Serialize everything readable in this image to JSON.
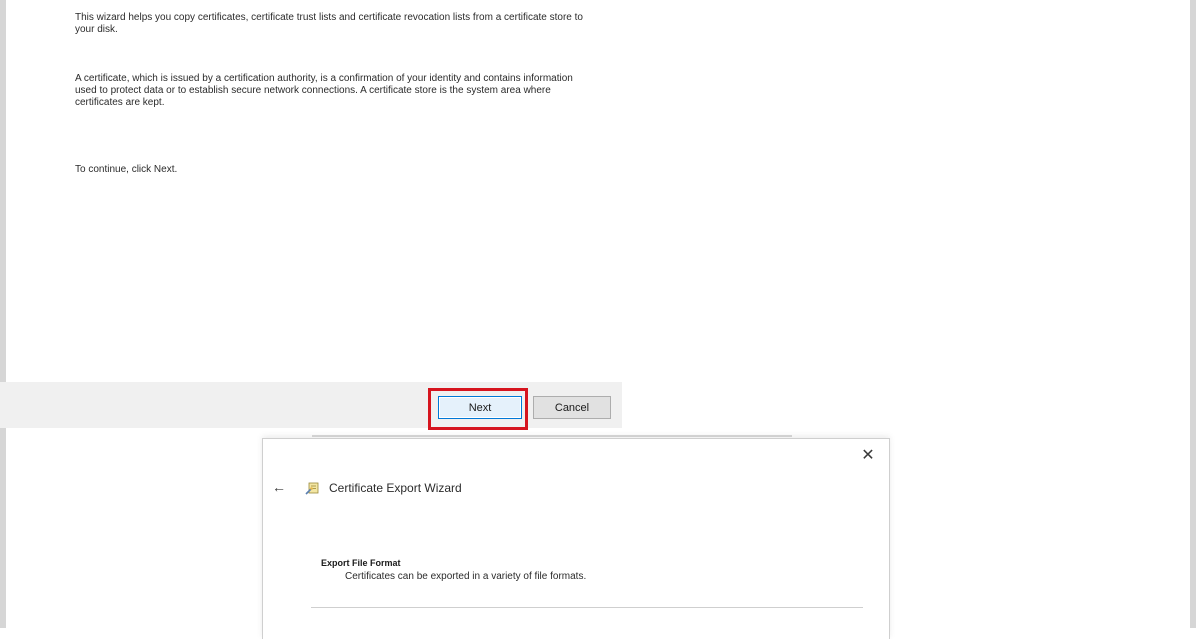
{
  "wizard_intro": {
    "paragraph1": "This wizard helps you copy certificates, certificate trust lists and certificate revocation lists from a certificate store to your disk.",
    "paragraph2": "A certificate, which is issued by a certification authority, is a confirmation of your identity and contains information used to protect data or to establish secure network connections. A certificate store is the system area where certificates are kept.",
    "paragraph3": "To continue, click Next."
  },
  "footer": {
    "next_label": "Next",
    "cancel_label": "Cancel",
    "highlight_color": "#d6141e"
  },
  "export_wizard": {
    "title": "Certificate Export Wizard",
    "close_icon": "close-icon",
    "back_icon": "back-arrow-icon",
    "app_icon": "certificate-wizard-icon",
    "section_title": "Export File Format",
    "section_description": "Certificates can be exported in a variety of file formats."
  }
}
